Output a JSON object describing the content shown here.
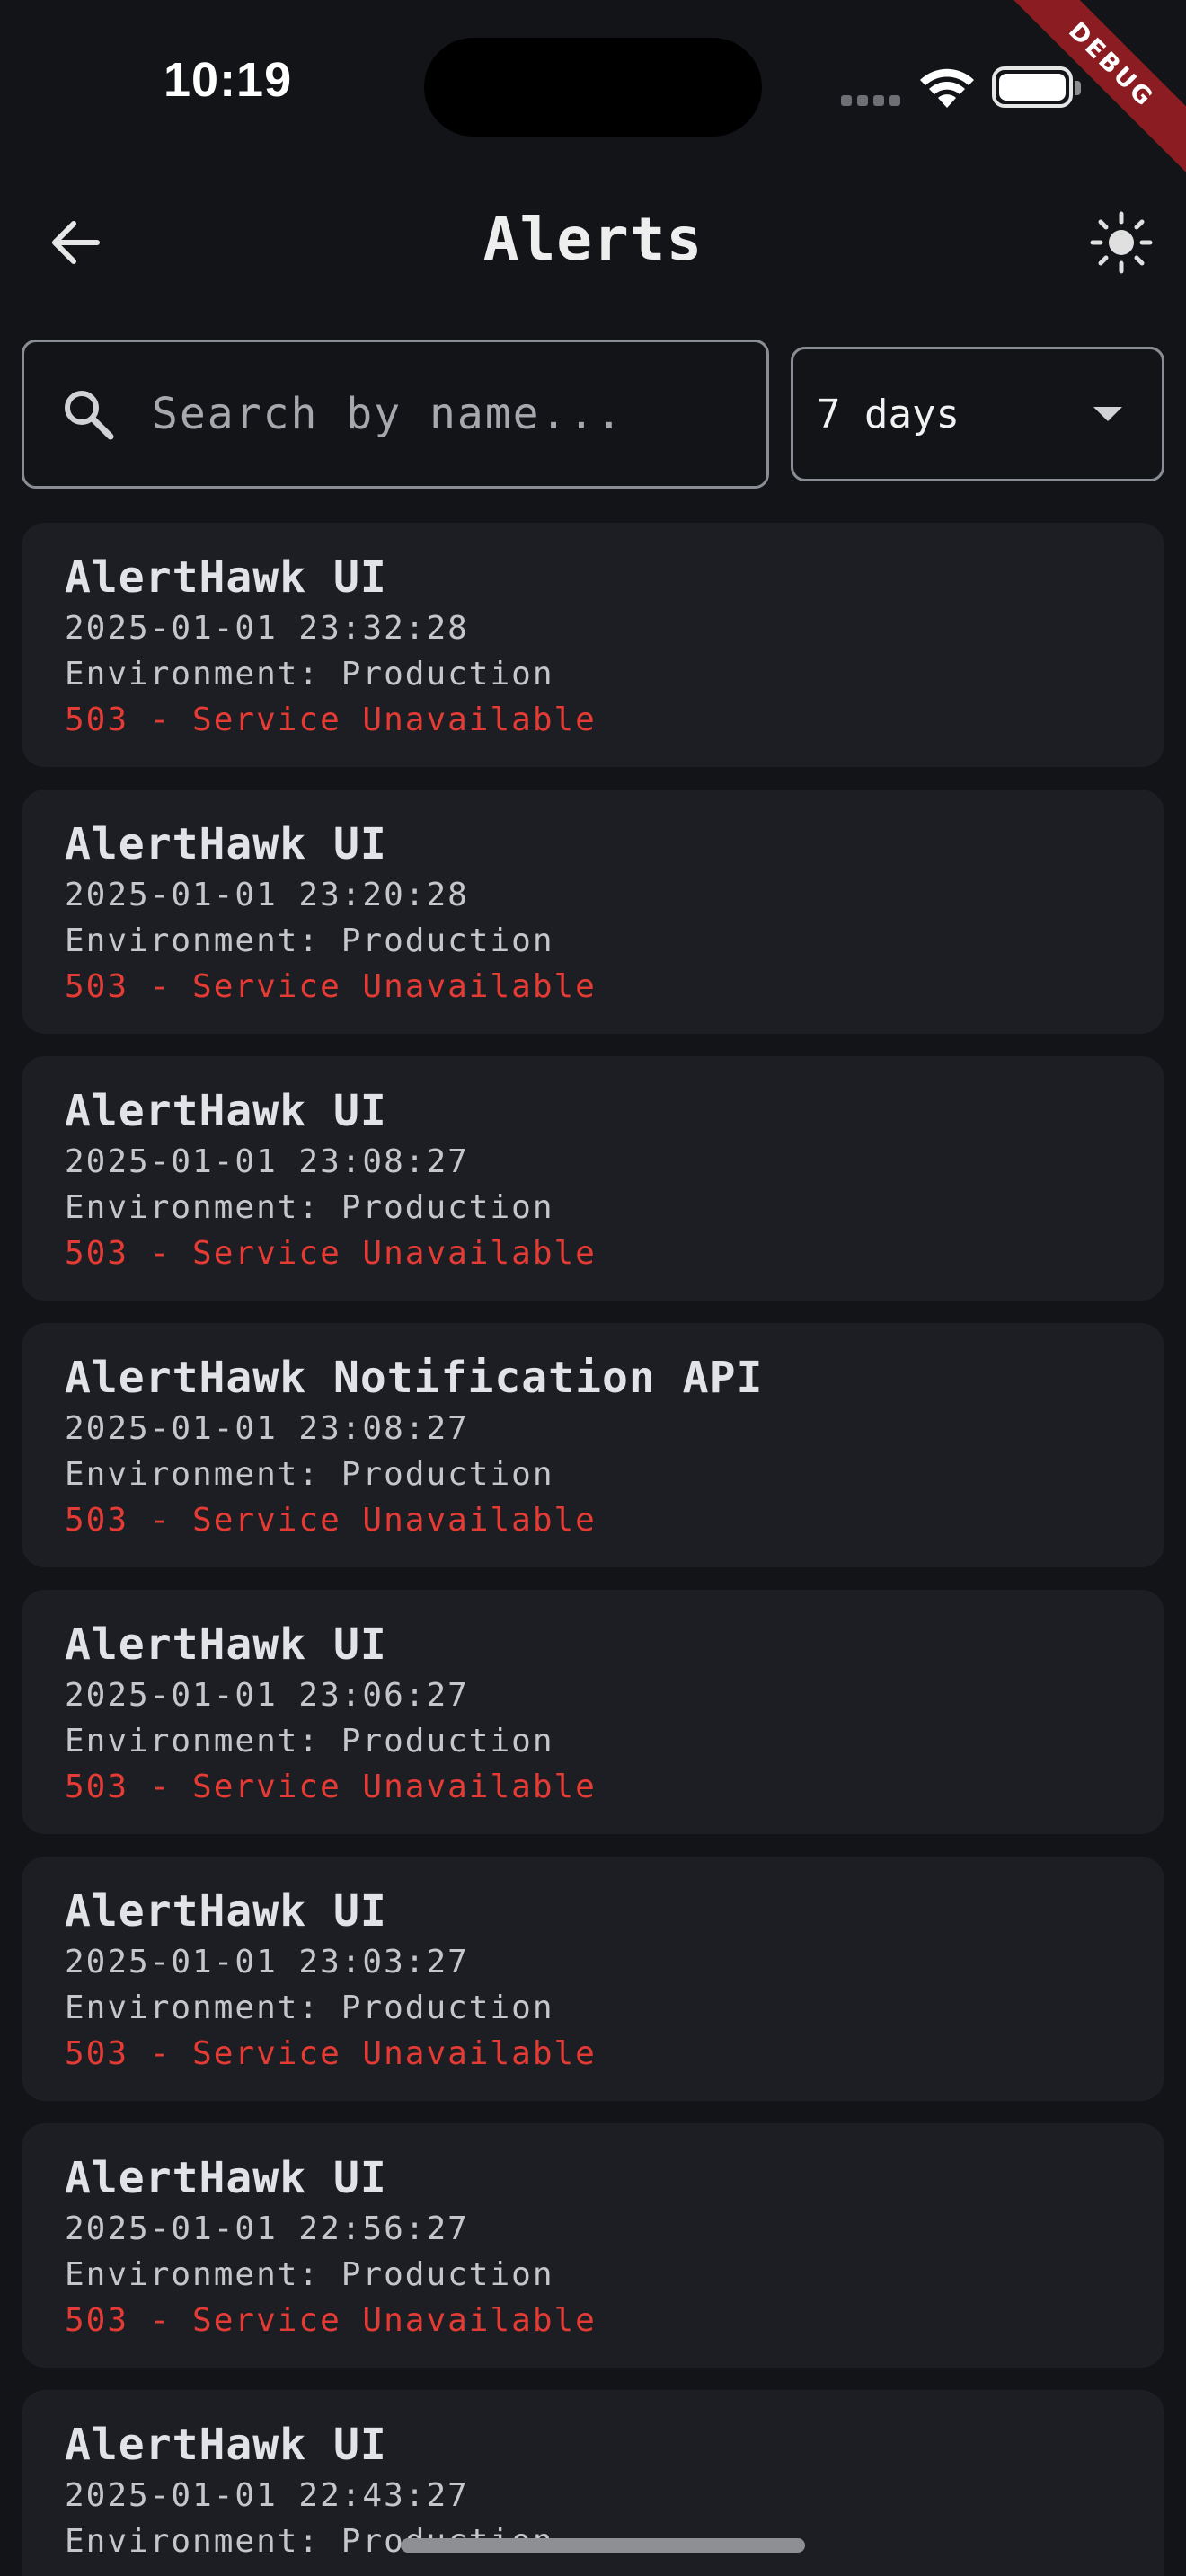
{
  "status_bar": {
    "time": "10:19"
  },
  "debug_label": "DEBUG",
  "app_bar": {
    "title": "Alerts"
  },
  "search": {
    "placeholder": "Search by name..."
  },
  "range_filter": {
    "selected": "7 days"
  },
  "alerts": [
    {
      "name": "AlertHawk UI",
      "time": "2025-01-01 23:32:28",
      "environment": "Environment: Production",
      "status": "503 - Service Unavailable"
    },
    {
      "name": "AlertHawk UI",
      "time": "2025-01-01 23:20:28",
      "environment": "Environment: Production",
      "status": "503 - Service Unavailable"
    },
    {
      "name": "AlertHawk UI",
      "time": "2025-01-01 23:08:27",
      "environment": "Environment: Production",
      "status": "503 - Service Unavailable"
    },
    {
      "name": "AlertHawk Notification API",
      "time": "2025-01-01 23:08:27",
      "environment": "Environment: Production",
      "status": "503 - Service Unavailable"
    },
    {
      "name": "AlertHawk UI",
      "time": "2025-01-01 23:06:27",
      "environment": "Environment: Production",
      "status": "503 - Service Unavailable"
    },
    {
      "name": "AlertHawk UI",
      "time": "2025-01-01 23:03:27",
      "environment": "Environment: Production",
      "status": "503 - Service Unavailable"
    },
    {
      "name": "AlertHawk UI",
      "time": "2025-01-01 22:56:27",
      "environment": "Environment: Production",
      "status": "503 - Service Unavailable"
    },
    {
      "name": "AlertHawk UI",
      "time": "2025-01-01 22:43:27",
      "environment": "Environment: Production",
      "status": ""
    }
  ],
  "colors": {
    "background": "#121418",
    "card": "#1c1e23",
    "error": "#e53b35",
    "debug_ribbon": "#8b1d22"
  },
  "icons": {
    "back": "arrow-left-icon",
    "theme": "sun-icon",
    "search": "search-icon",
    "dropdown": "caret-down-icon"
  }
}
